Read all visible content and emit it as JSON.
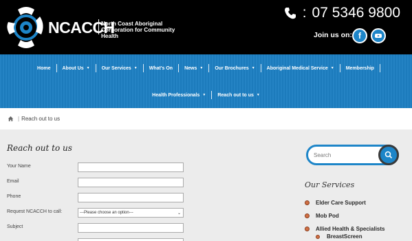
{
  "header": {
    "brand": "NCACCH",
    "brand_sub": "North Coast Aboriginal Corporation for Community Health",
    "phone": "07 5346 9800",
    "join_label": "Join us on:",
    "social": [
      "f",
      "You Tube"
    ]
  },
  "nav": {
    "row1": [
      {
        "label": "Home",
        "caret": false
      },
      {
        "label": "About Us",
        "caret": true
      },
      {
        "label": "Our Services",
        "caret": true
      },
      {
        "label": "What's On",
        "caret": false
      },
      {
        "label": "News",
        "caret": true
      },
      {
        "label": "Our Brochures",
        "caret": true
      },
      {
        "label": "Aboriginal Medical Service",
        "caret": true
      },
      {
        "label": "Membership",
        "caret": false
      }
    ],
    "row2": [
      {
        "label": "Health Professionals",
        "caret": true
      },
      {
        "label": "Reach out to us",
        "caret": true
      }
    ]
  },
  "breadcrumb": {
    "current": "Reach out to us"
  },
  "content": {
    "title": "Reach out to us",
    "fields": {
      "name": "Your Name",
      "email": "Email",
      "phone": "Phone",
      "request": "Request NCACCH to call:",
      "request_value": "---Please choose an option---",
      "subject": "Subject"
    }
  },
  "sidebar": {
    "search_placeholder": "Search",
    "services_title": "Our Services",
    "services": [
      "Elder Care Support",
      "Mob Pod",
      "Allied Health & Specialists"
    ],
    "subservices": [
      "BreastScreen"
    ]
  },
  "colors": {
    "accent": "#1d85c8",
    "nav_bg": "#1d7fc2",
    "bullet": "#d07045"
  }
}
